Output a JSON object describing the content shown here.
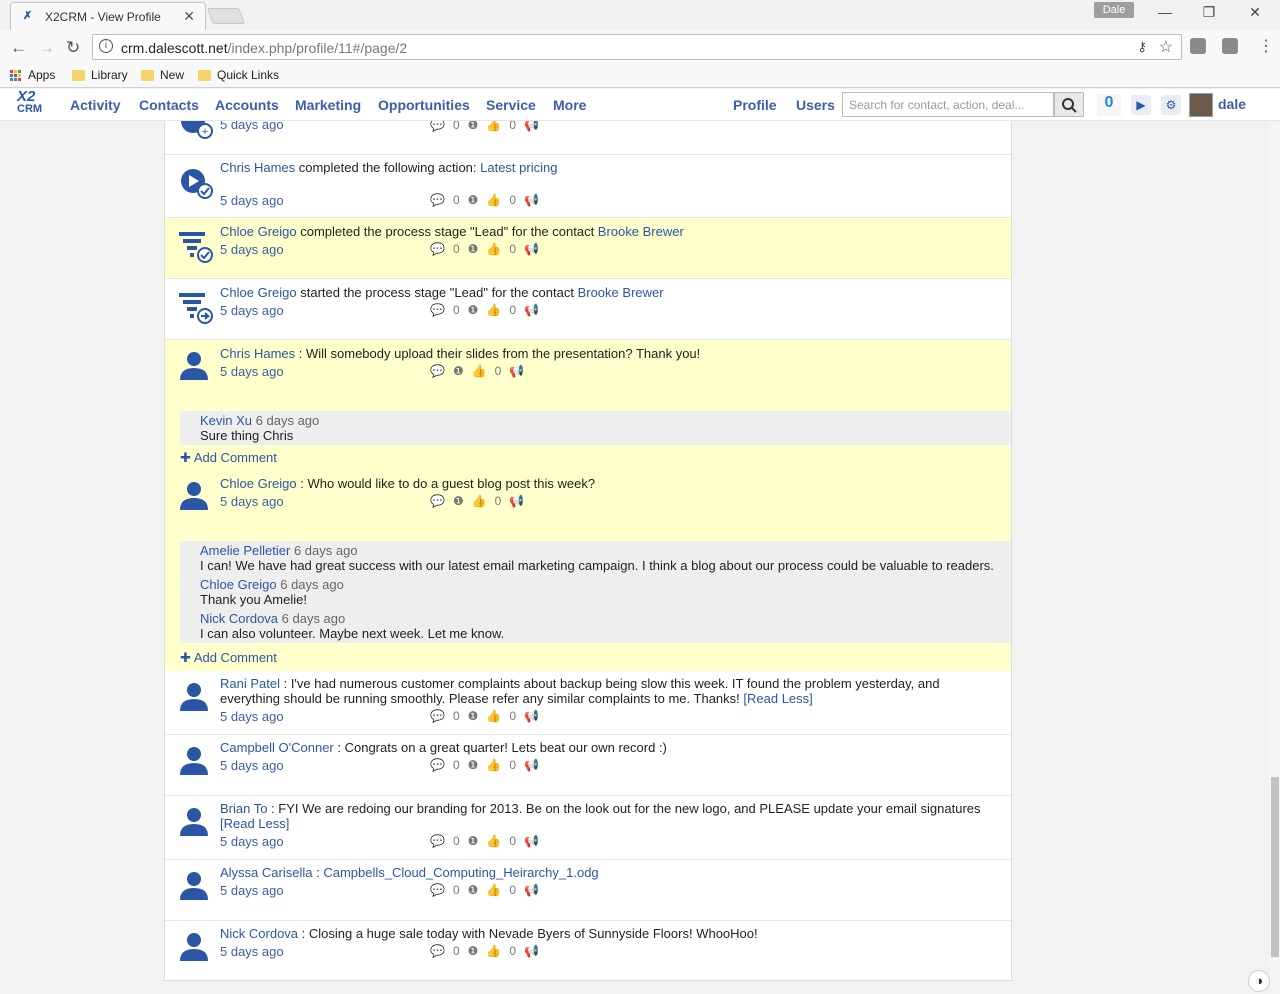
{
  "browser": {
    "tab_title": "X2CRM - View Profile",
    "tab_close": "✕",
    "profile_badge": "Dale",
    "url_host": "crm.dalescott.net",
    "url_path": "/index.php/profile/11#/page/2",
    "bookmarks": [
      "Apps",
      "Library",
      "New",
      "Quick Links"
    ]
  },
  "nav": {
    "logo_top": "X2",
    "logo_bottom": "CRM",
    "left": [
      "Activity",
      "Contacts",
      "Accounts",
      "Marketing",
      "Opportunities",
      "Service",
      "More"
    ],
    "right": [
      "Profile",
      "Users"
    ],
    "search_placeholder": "Search for contact, action, deal...",
    "notifications": "0",
    "user": "dale"
  },
  "feed": {
    "ago": "5 days ago",
    "count_zero": "0",
    "add_comment": "Add Comment",
    "items": [
      {
        "author": "Chris Hames",
        "text": " completed the following action: ",
        "link": "Latest pricing"
      },
      {
        "author": "Chloe Greigo",
        "text": " completed the process stage \"Lead\" for the contact ",
        "link": "Brooke Brewer"
      },
      {
        "author": "Chloe Greigo",
        "text": " started the process stage \"Lead\" for the contact ",
        "link": "Brooke Brewer"
      },
      {
        "author": "Chris Hames",
        "text": " : Will somebody upload their slides from the presentation? Thank you!"
      },
      {
        "author": "Chloe Greigo",
        "text": " : Who would like to do a guest blog post this week?"
      },
      {
        "author": "Rani Patel",
        "text": " : I've had numerous customer complaints about backup being slow this week. IT found the problem yesterday, and everything should be running smoothly. Please refer any similar complaints to me. Thanks! ",
        "link": "[Read Less]"
      },
      {
        "author": "Campbell O'Conner",
        "text": " : Congrats on a great quarter! Lets beat our own record :)"
      },
      {
        "author": "Brian To",
        "text": " : FYI We are redoing our branding for 2013. Be on the look out for the new logo, and PLEASE update your email signatures ",
        "link": "[Read Less]"
      },
      {
        "author": "Alyssa Carisella",
        "text": " : ",
        "link": "Campbells_Cloud_Computing_Heirarchy_1.odg"
      },
      {
        "author": "Nick Cordova",
        "text": " : Closing a huge sale today with Nevade Byers of Sunnyside Floors! WhooHoo!"
      }
    ],
    "comments_a": [
      {
        "author": "Kevin Xu",
        "when": " 6 days ago",
        "text": "Sure thing Chris"
      }
    ],
    "comments_b": [
      {
        "author": "Amelie Pelletier",
        "when": " 6 days ago",
        "text": "I can! We have had great success with our latest email marketing campaign. I think a blog about our process could be valuable to readers."
      },
      {
        "author": "Chloe Greigo",
        "when": " 6 days ago",
        "text": "Thank you Amelie!"
      },
      {
        "author": "Nick Cordova",
        "when": " 6 days ago",
        "text": "I can also volunteer. Maybe next week. Let me know."
      }
    ]
  },
  "colors": {
    "accent": "#2a56a5",
    "highlight": "#ffffcc",
    "nav_link": "#3a5fa8"
  }
}
